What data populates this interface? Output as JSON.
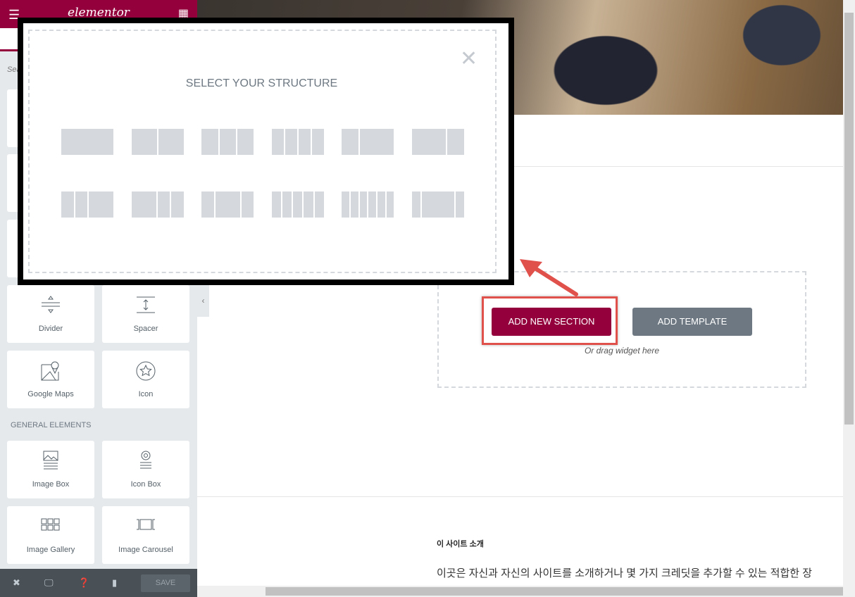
{
  "sidebar": {
    "logo": "elementor",
    "search_placeholder": "Search Widget...",
    "widgets": [
      {
        "label": "Divider",
        "icon": "divider-icon"
      },
      {
        "label": "Spacer",
        "icon": "spacer-icon"
      },
      {
        "label": "Google Maps",
        "icon": "google-maps-icon"
      },
      {
        "label": "Icon",
        "icon": "star-icon"
      }
    ],
    "category": "GENERAL ELEMENTS",
    "general_widgets": [
      {
        "label": "Image Box",
        "icon": "image-box-icon"
      },
      {
        "label": "Icon Box",
        "icon": "icon-box-icon"
      },
      {
        "label": "Image Gallery",
        "icon": "image-gallery-icon"
      },
      {
        "label": "Image Carousel",
        "icon": "image-carousel-icon"
      }
    ],
    "footer": {
      "save_label": "SAVE"
    }
  },
  "canvas": {
    "add_section_label": "ADD NEW SECTION",
    "add_template_label": "ADD TEMPLATE",
    "drag_hint": "Or drag widget here",
    "about_title": "이 사이트 소개",
    "about_text": "이곳은 자신과 자신의 사이트를 소개하거나 몇 가지 크레딧을 추가할 수 있는 적합한 장소입니다."
  },
  "modal": {
    "title": "SELECT YOUR STRUCTURE",
    "structures": [
      [
        1
      ],
      [
        1,
        1
      ],
      [
        1,
        1,
        1
      ],
      [
        1,
        1,
        1,
        1
      ],
      [
        1,
        2
      ],
      [
        2,
        1
      ],
      [
        1,
        1,
        2
      ],
      [
        2,
        1,
        1
      ],
      [
        1,
        2,
        1
      ],
      [
        1,
        1,
        1,
        1,
        1
      ],
      [
        1,
        1,
        1,
        1,
        1,
        1
      ],
      [
        1,
        4,
        1
      ]
    ]
  },
  "colors": {
    "brand": "#93003c",
    "secondary": "#6d7882",
    "annotation": "#e0514b"
  }
}
